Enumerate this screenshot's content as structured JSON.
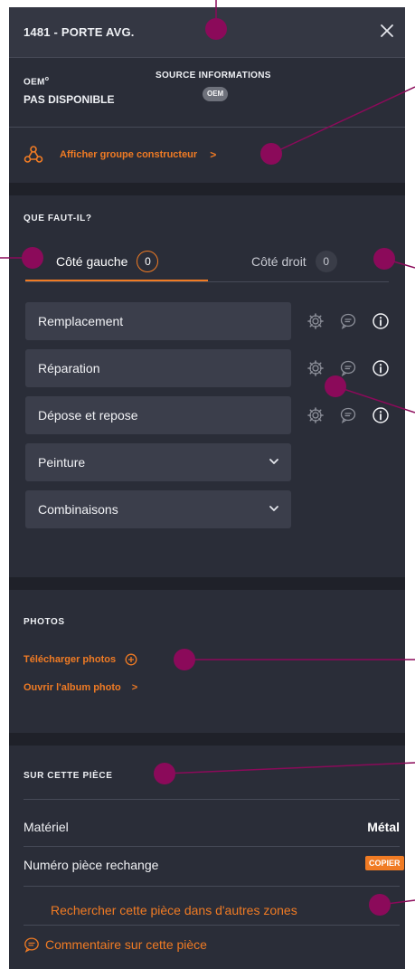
{
  "header": {
    "title": "1481 - PORTE AVG."
  },
  "info": {
    "oem_label": "OEM",
    "oem_superscript": "o",
    "oem_value": "PAS DISPONIBLE",
    "source_label": "SOURCE INFORMATIONS",
    "source_badge": "OEM"
  },
  "group_link": {
    "label": "Afficher groupe constructeur",
    "chevron": ">"
  },
  "what": {
    "section_label": "QUE FAUT-IL?",
    "tabs": [
      {
        "label": "Côté gauche",
        "count": "0",
        "active": true
      },
      {
        "label": "Côté droit",
        "count": "0",
        "active": false
      }
    ],
    "actions": [
      {
        "label": "Remplacement"
      },
      {
        "label": "Réparation"
      },
      {
        "label": "Dépose et repose"
      }
    ],
    "dropdowns": [
      {
        "label": "Peinture"
      },
      {
        "label": "Combinaisons"
      }
    ]
  },
  "photos": {
    "section_label": "PHOTOS",
    "upload_label": "Télécharger photos",
    "album_label": "Ouvrir l'album photo",
    "chevron": ">"
  },
  "part": {
    "section_label": "SUR CETTE PIÈCE",
    "material_label": "Matériel",
    "material_value": "Métal",
    "spare_label": "Numéro pièce rechange",
    "copy_label": "COPIER",
    "search_label": "Rechercher cette pièce dans d'autres zones",
    "comment_label": "Commentaire sur cette pièce"
  },
  "colors": {
    "accent": "#f07b24",
    "panel": "#2a2d38",
    "annotation": "#8b0a5a"
  }
}
